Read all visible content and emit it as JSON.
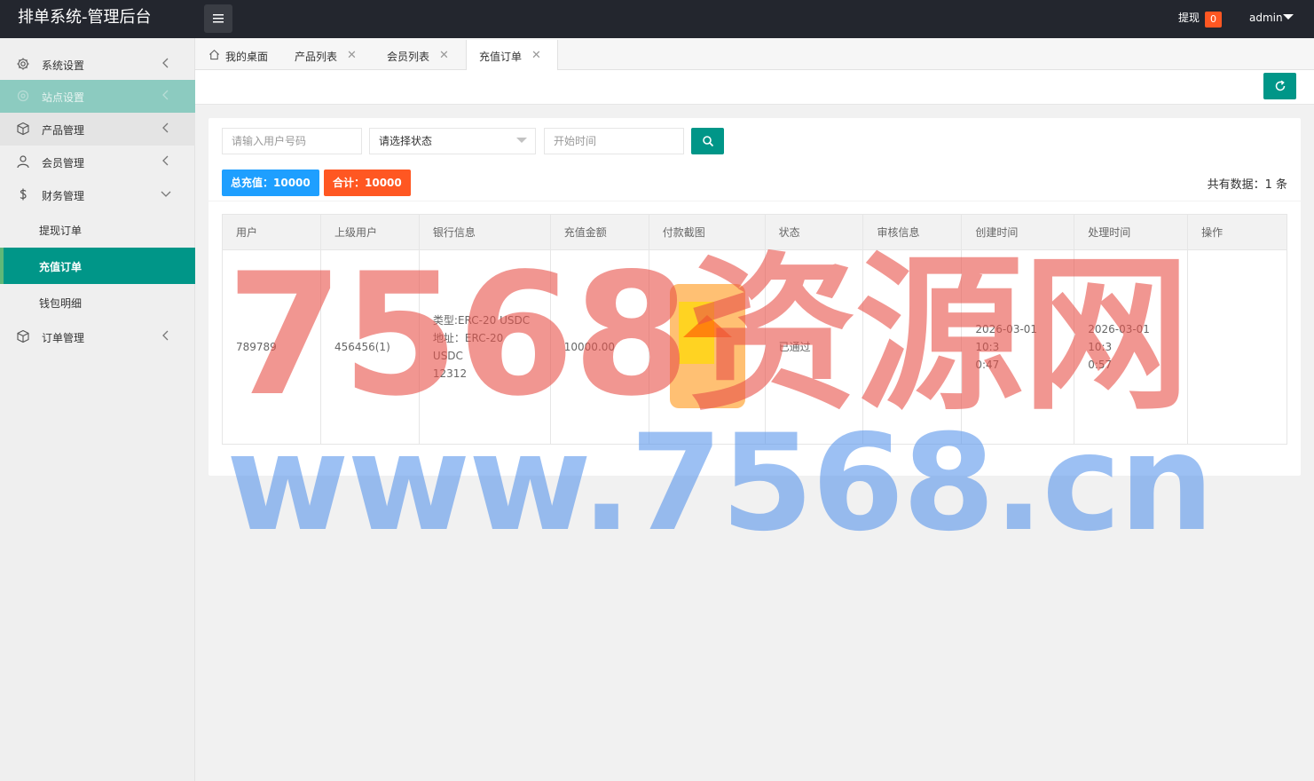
{
  "header": {
    "title": "排单系统-管理后台",
    "withdraw_label": "提现",
    "withdraw_count": "0",
    "user_name": "admin"
  },
  "sidebar": {
    "items": [
      {
        "label": "系统设置",
        "icon": "gear-icon"
      },
      {
        "label": "站点设置",
        "icon": "site-icon"
      },
      {
        "label": "产品管理",
        "icon": "cube-icon"
      },
      {
        "label": "会员管理",
        "icon": "user-icon"
      },
      {
        "label": "财务管理",
        "icon": "dollar-icon"
      },
      {
        "label": "订单管理",
        "icon": "cube-icon"
      }
    ],
    "sub_items": [
      {
        "label": "提现订单"
      },
      {
        "label": "充值订单",
        "active": true
      },
      {
        "label": "钱包明细"
      }
    ]
  },
  "tabs": [
    {
      "label": "我的桌面",
      "icon": "home-icon"
    },
    {
      "label": "产品列表",
      "close": "✕"
    },
    {
      "label": "会员列表",
      "close": "✕"
    },
    {
      "label": "充值订单",
      "close": "✕",
      "active": true
    }
  ],
  "filters": {
    "user_placeholder": "请输入用户号码",
    "status_selected": "请选择状态",
    "start_placeholder": "开始时间"
  },
  "summary": {
    "total_recharge": "总充值：10000",
    "sum": "合计：10000",
    "record_count": "共有数据：1 条"
  },
  "table": {
    "columns": [
      "用户",
      "上级用户",
      "银行信息",
      "充值金额",
      "付款截图",
      "状态",
      "审核信息",
      "创建时间",
      "处理时间",
      "操作"
    ],
    "rows": [
      {
        "user": "789789",
        "parent": "456456(1)",
        "bank_line1": "类型:ERC-20 USDC",
        "bank_line2": "地址：ERC-20 USDC",
        "bank_line3": "12312",
        "amount": "10000.00",
        "screenshot": "",
        "status": "已通过",
        "review": "",
        "created_l1": "2026-03-01 10:3",
        "created_l2": "0:47",
        "processed_l1": "2026-03-01 10:3",
        "processed_l2": "0:57",
        "action": ""
      }
    ]
  },
  "watermark": {
    "line1": "7568资源网",
    "line2": "www.7568.cn"
  },
  "colors": {
    "primary": "#009688",
    "header_bg": "#23262e",
    "blue_badge": "#1e9fff",
    "orange_badge": "#ff5722"
  }
}
